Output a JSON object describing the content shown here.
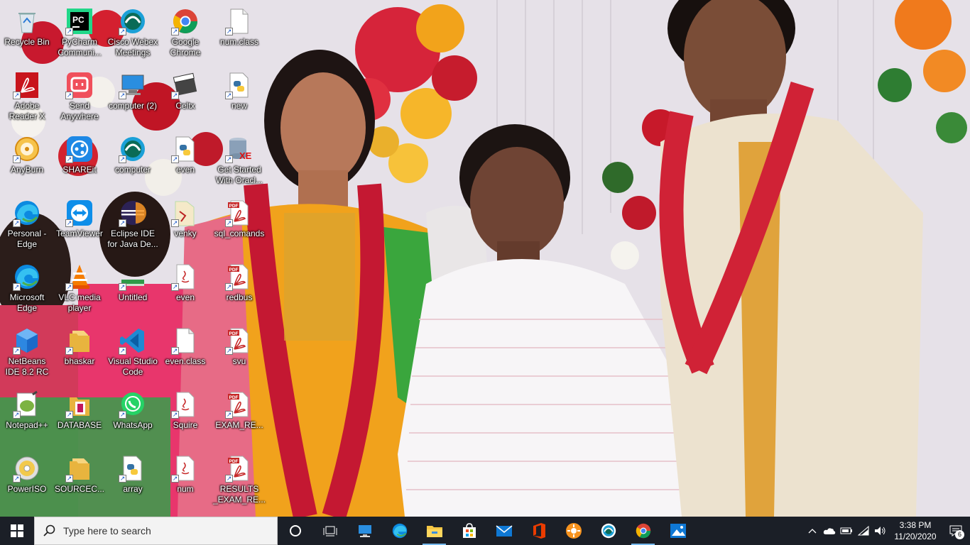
{
  "desktop": {
    "icons": [
      {
        "label": "Recycle Bin",
        "icon": "recycle-bin-icon"
      },
      {
        "label": "PyCharm Communi...",
        "icon": "pycharm-icon"
      },
      {
        "label": "Cisco Webex Meetings",
        "icon": "webex-icon"
      },
      {
        "label": "Google Chrome",
        "icon": "chrome-icon"
      },
      {
        "label": "num.class",
        "icon": "file-icon"
      },
      {
        "label": "Adobe Reader X",
        "icon": "adobe-reader-icon"
      },
      {
        "label": "Send Anywhere",
        "icon": "send-anywhere-icon"
      },
      {
        "label": "computer (2)",
        "icon": "computer-icon"
      },
      {
        "label": "Celtx",
        "icon": "celtx-icon"
      },
      {
        "label": "new",
        "icon": "python-file-icon"
      },
      {
        "label": "AnyBurn",
        "icon": "anyburn-icon"
      },
      {
        "label": "SHAREit",
        "icon": "shareit-icon"
      },
      {
        "label": "computer",
        "icon": "webex-icon"
      },
      {
        "label": "even",
        "icon": "python-file-icon"
      },
      {
        "label": "Get Started With Oracl...",
        "icon": "oracle-xe-icon"
      },
      {
        "label": "Personal - Edge",
        "icon": "edge-icon"
      },
      {
        "label": "TeamViewer",
        "icon": "teamviewer-icon"
      },
      {
        "label": "Eclipse IDE for Java De...",
        "icon": "eclipse-icon"
      },
      {
        "label": "venky",
        "icon": "pdf-folder-icon"
      },
      {
        "label": "sql_comands",
        "icon": "pdf-icon"
      },
      {
        "label": "Microsoft Edge",
        "icon": "edge-icon"
      },
      {
        "label": "VLC media player",
        "icon": "vlc-icon"
      },
      {
        "label": "Untitled",
        "icon": "untitled-icon"
      },
      {
        "label": "even",
        "icon": "java-file-icon"
      },
      {
        "label": "redbus",
        "icon": "pdf-icon"
      },
      {
        "label": "NetBeans IDE 8.2 RC",
        "icon": "netbeans-icon"
      },
      {
        "label": "bhaskar",
        "icon": "folder-icon"
      },
      {
        "label": "Visual Studio Code",
        "icon": "vscode-icon"
      },
      {
        "label": "even.class",
        "icon": "file-icon"
      },
      {
        "label": "svu",
        "icon": "pdf-icon"
      },
      {
        "label": "Notepad++",
        "icon": "notepadpp-icon"
      },
      {
        "label": "DATABASE",
        "icon": "database-folder-icon"
      },
      {
        "label": "WhatsApp",
        "icon": "whatsapp-icon"
      },
      {
        "label": "Squire",
        "icon": "java-file-icon"
      },
      {
        "label": "EXAM_RE...",
        "icon": "pdf-icon"
      },
      {
        "label": "PowerISO",
        "icon": "poweriso-icon"
      },
      {
        "label": "SOURCEC...",
        "icon": "folder-icon"
      },
      {
        "label": "array",
        "icon": "python-file-icon"
      },
      {
        "label": "num",
        "icon": "java-file-icon"
      },
      {
        "label": "RESULTS _EXAM_RE...",
        "icon": "pdf-icon"
      }
    ]
  },
  "taskbar": {
    "search_placeholder": "Type here to search",
    "apps": [
      {
        "name": "cortana-icon"
      },
      {
        "name": "task-view-icon"
      },
      {
        "name": "computer-app-icon"
      },
      {
        "name": "edge-taskbar-icon"
      },
      {
        "name": "file-explorer-icon",
        "active": true
      },
      {
        "name": "store-icon"
      },
      {
        "name": "mail-icon"
      },
      {
        "name": "office-icon"
      },
      {
        "name": "sunflower-app-icon"
      },
      {
        "name": "webex-taskbar-icon"
      },
      {
        "name": "chrome-taskbar-icon",
        "active": true
      },
      {
        "name": "photos-icon"
      }
    ],
    "tray": {
      "time": "3:38 PM",
      "date": "11/20/2020",
      "notification_count": "6"
    }
  }
}
